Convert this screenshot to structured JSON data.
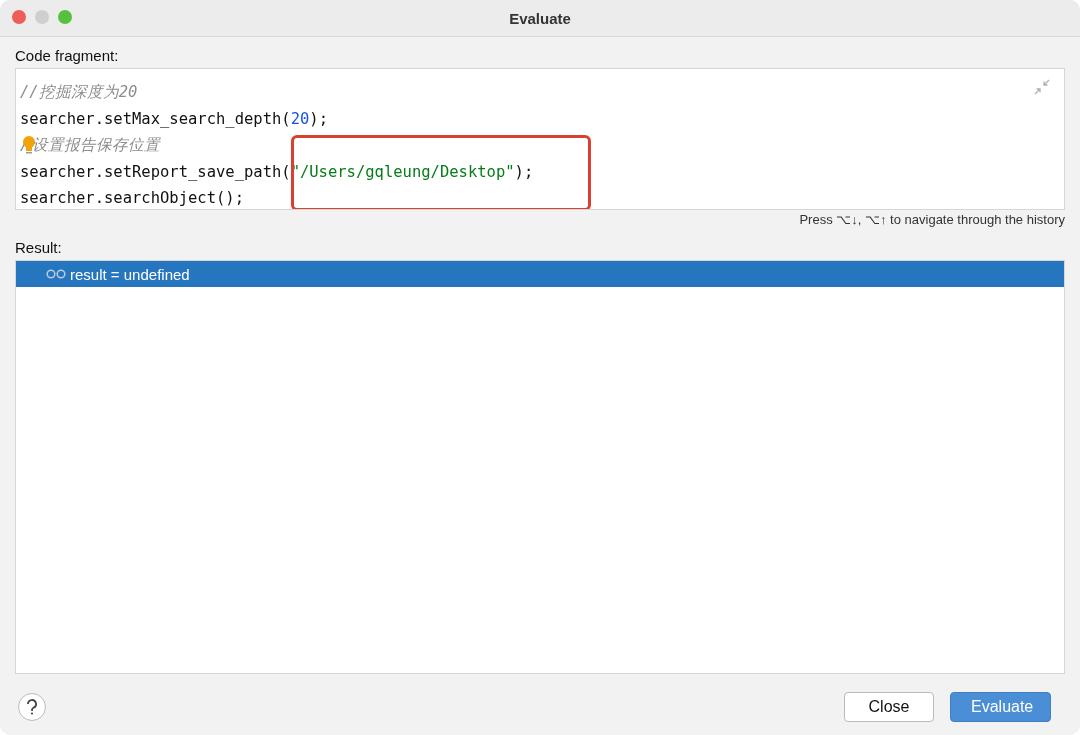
{
  "window": {
    "title": "Evaluate"
  },
  "code_fragment": {
    "label": "Code fragment:",
    "highlight_box": true,
    "lines": [
      {
        "segments": [
          {
            "kind": "comment",
            "text": "//挖掘深度为20"
          }
        ]
      },
      {
        "segments": [
          {
            "kind": "plain",
            "text": "searcher.setMax_search_depth("
          },
          {
            "kind": "number",
            "text": "20"
          },
          {
            "kind": "plain",
            "text": ");"
          }
        ]
      },
      {
        "segments": [
          {
            "kind": "comment",
            "text": "/"
          },
          {
            "kind": "bulb"
          },
          {
            "kind": "comment",
            "text": "设置报告保存位置"
          }
        ]
      },
      {
        "segments": [
          {
            "kind": "plain",
            "text": "searcher.setReport_save_path("
          },
          {
            "kind": "string",
            "text": "\"/Users/gqleung/Desktop\""
          },
          {
            "kind": "plain",
            "text": ");"
          }
        ]
      },
      {
        "segments": [
          {
            "kind": "plain",
            "text": "searcher.searchObject();"
          }
        ]
      }
    ],
    "hint": "Press ⌥↓, ⌥↑ to navigate through the history"
  },
  "result": {
    "label": "Result:",
    "rows": [
      {
        "text": "result = undefined",
        "selected": true
      }
    ]
  },
  "buttons": [
    {
      "label": "Close",
      "kind": "default"
    },
    {
      "label": "Evaluate",
      "kind": "primary"
    }
  ]
}
